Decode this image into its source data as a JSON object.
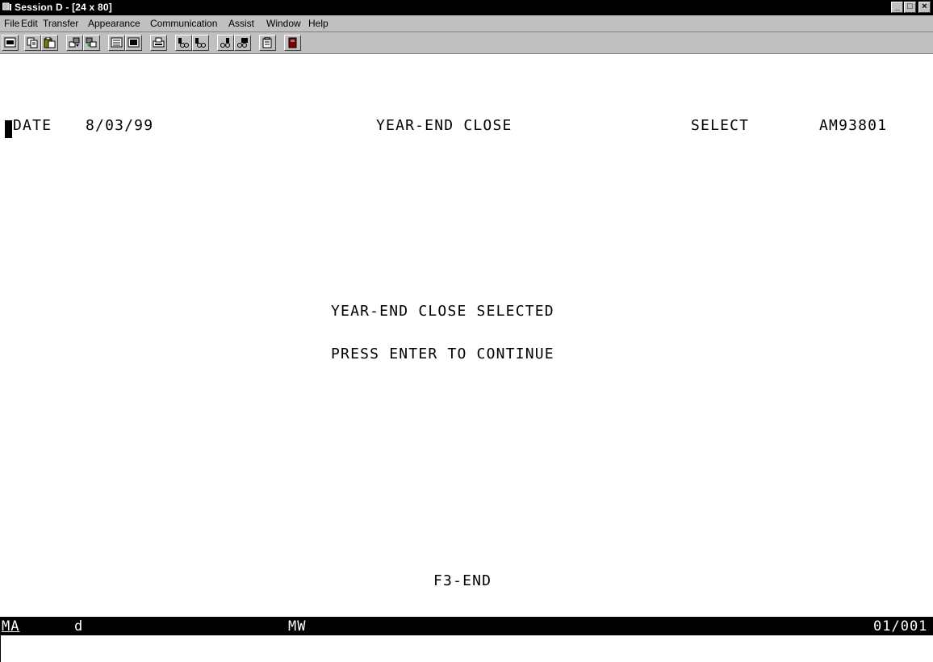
{
  "window": {
    "title": "Session D - [24 x 80]",
    "controls": [
      "_",
      "□",
      "×"
    ]
  },
  "menu": [
    {
      "label": "File"
    },
    {
      "label": "Edit"
    },
    {
      "label": "Transfer"
    },
    {
      "label": "Appearance"
    },
    {
      "label": "Communication"
    },
    {
      "label": "Assist"
    },
    {
      "label": "Window"
    },
    {
      "label": "Help"
    }
  ],
  "toolbar": {
    "icons": [
      "session-icon",
      "copy-icon",
      "paste-icon",
      "send-file-icon",
      "receive-file-icon",
      "keypad-icon",
      "display-setup-icon",
      "print-screen-icon",
      "macro-record-icon",
      "macro-play-icon",
      "macro-stop-icon",
      "macro-edit-icon",
      "clipboard-icon",
      "help-book-icon"
    ]
  },
  "terminal": {
    "date_label": "DATE",
    "date_value": "8/03/99",
    "screen_title": "YEAR-END CLOSE",
    "mode": "SELECT",
    "program_id": "AM93801",
    "message_1": "YEAR-END CLOSE SELECTED",
    "message_2": "PRESS ENTER TO CONTINUE",
    "function_keys": "F3-END"
  },
  "status": {
    "session_indicator": "MA",
    "session_letter": "d",
    "mode_indicator": "MW",
    "cursor_position": "01/001"
  }
}
